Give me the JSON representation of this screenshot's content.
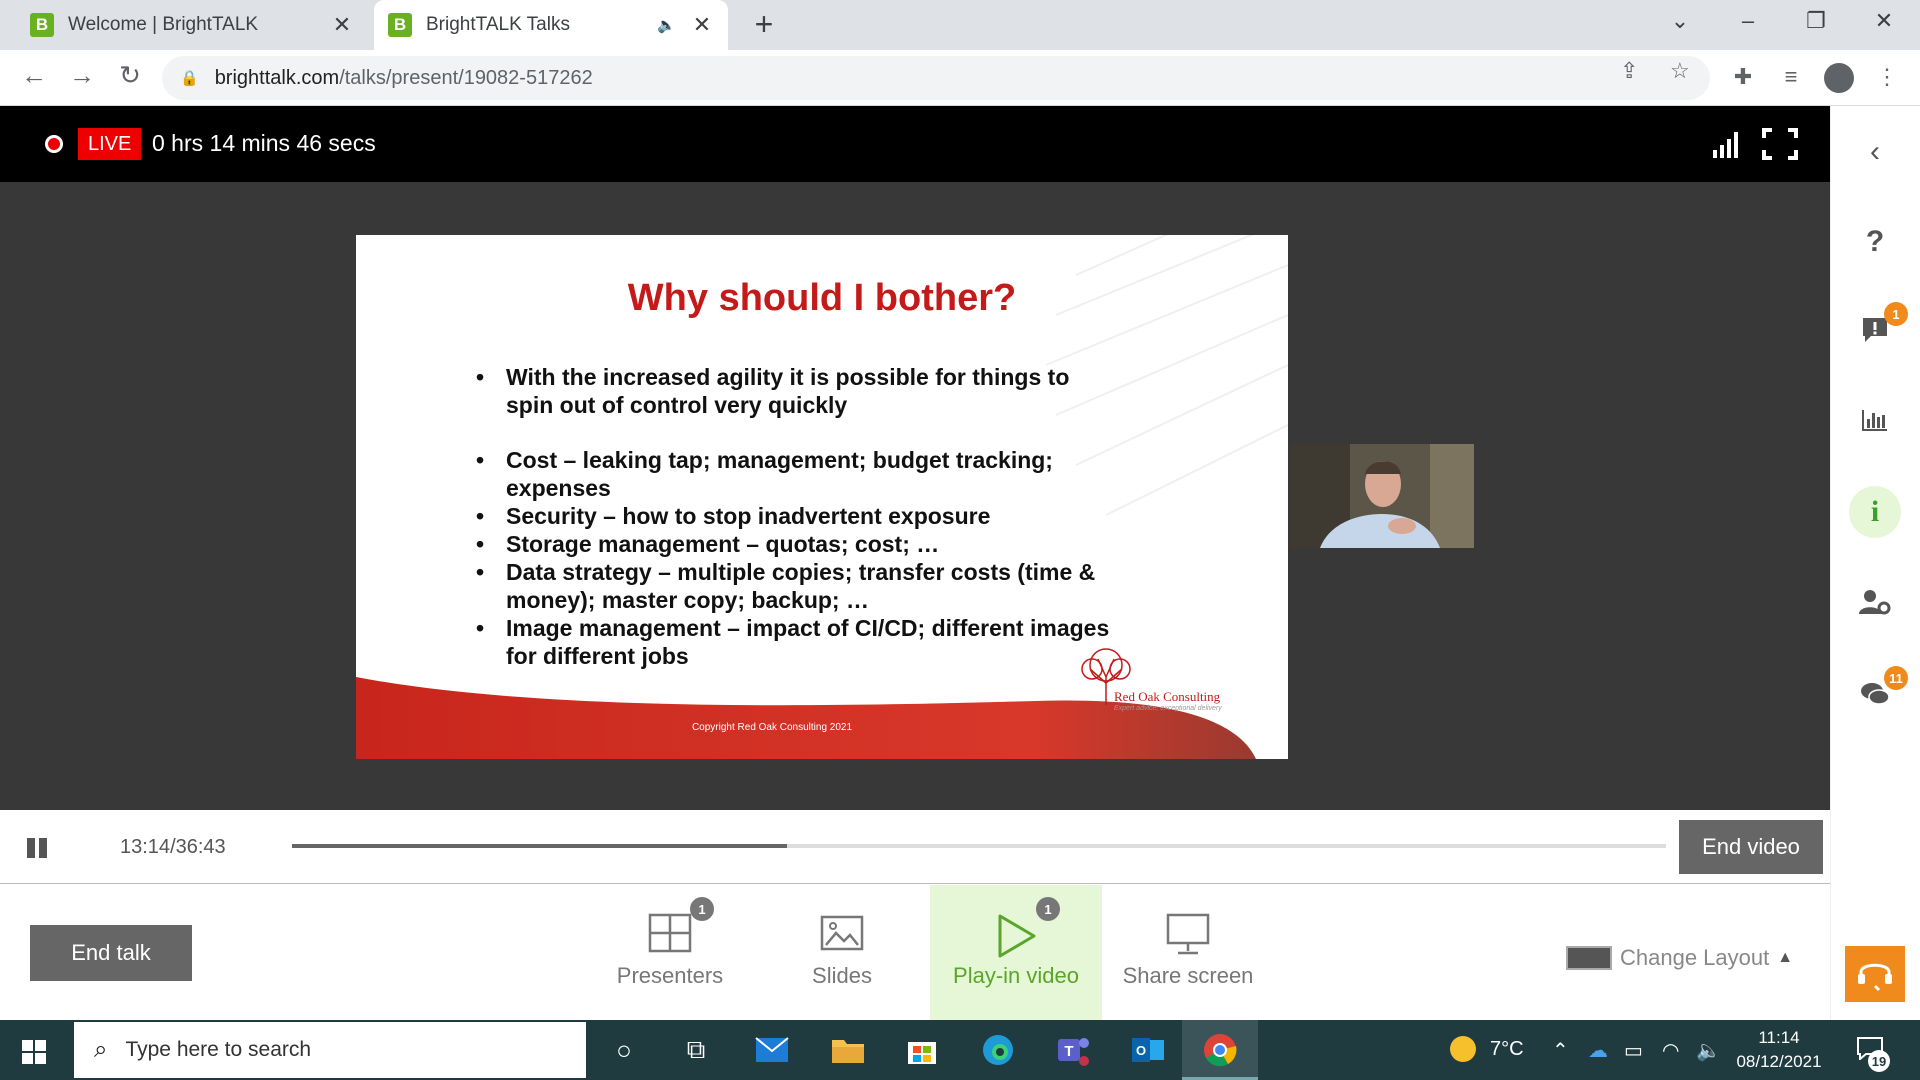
{
  "browser": {
    "tabs": [
      {
        "title": "Welcome | BrightTALK",
        "favicon": "B"
      },
      {
        "title": "BrightTALK Talks",
        "favicon": "B"
      }
    ],
    "url_host": "brighttalk.com",
    "url_path": "/talks/present/19082-517262",
    "accent": "#6ab023"
  },
  "live": {
    "badge": "LIVE",
    "elapsed": "0 hrs 14 mins 46 secs"
  },
  "slide": {
    "title": "Why should I bother?",
    "bullets": [
      "With the increased agility it is possible for things to spin out of control very quickly",
      "Cost – leaking tap; management; budget tracking; expenses",
      "Security – how to stop inadvertent exposure",
      "Storage management – quotas; cost; …",
      "Data strategy – multiple copies; transfer costs (time & money); master copy; backup; …",
      "Image management – impact of CI/CD; different images for different jobs"
    ],
    "copyright": "Copyright Red Oak Consulting 2021",
    "logo_name": "Red Oak Consulting",
    "logo_tagline": "Expert advice, exceptional delivery",
    "title_color": "#c41a1a"
  },
  "player": {
    "current": "13:14",
    "separator": "/",
    "duration": "36:43",
    "progress": 0.36,
    "end_video_label": "End video"
  },
  "controls": {
    "end_talk_label": "End talk",
    "presenters": {
      "label": "Presenters",
      "badge": "1"
    },
    "slides": {
      "label": "Slides"
    },
    "playin": {
      "label": "Play-in video",
      "badge": "1"
    },
    "share": {
      "label": "Share screen"
    },
    "layout_label": "Change Layout"
  },
  "sidebar": {
    "help": "?",
    "questions_badge": "1",
    "info": "i",
    "chat_badge": "11",
    "badge_color": "#f08a1c"
  },
  "taskbar": {
    "search_placeholder": "Type here to search",
    "temperature": "7°C",
    "time": "11:14",
    "date": "08/12/2021",
    "notifications": "19"
  }
}
